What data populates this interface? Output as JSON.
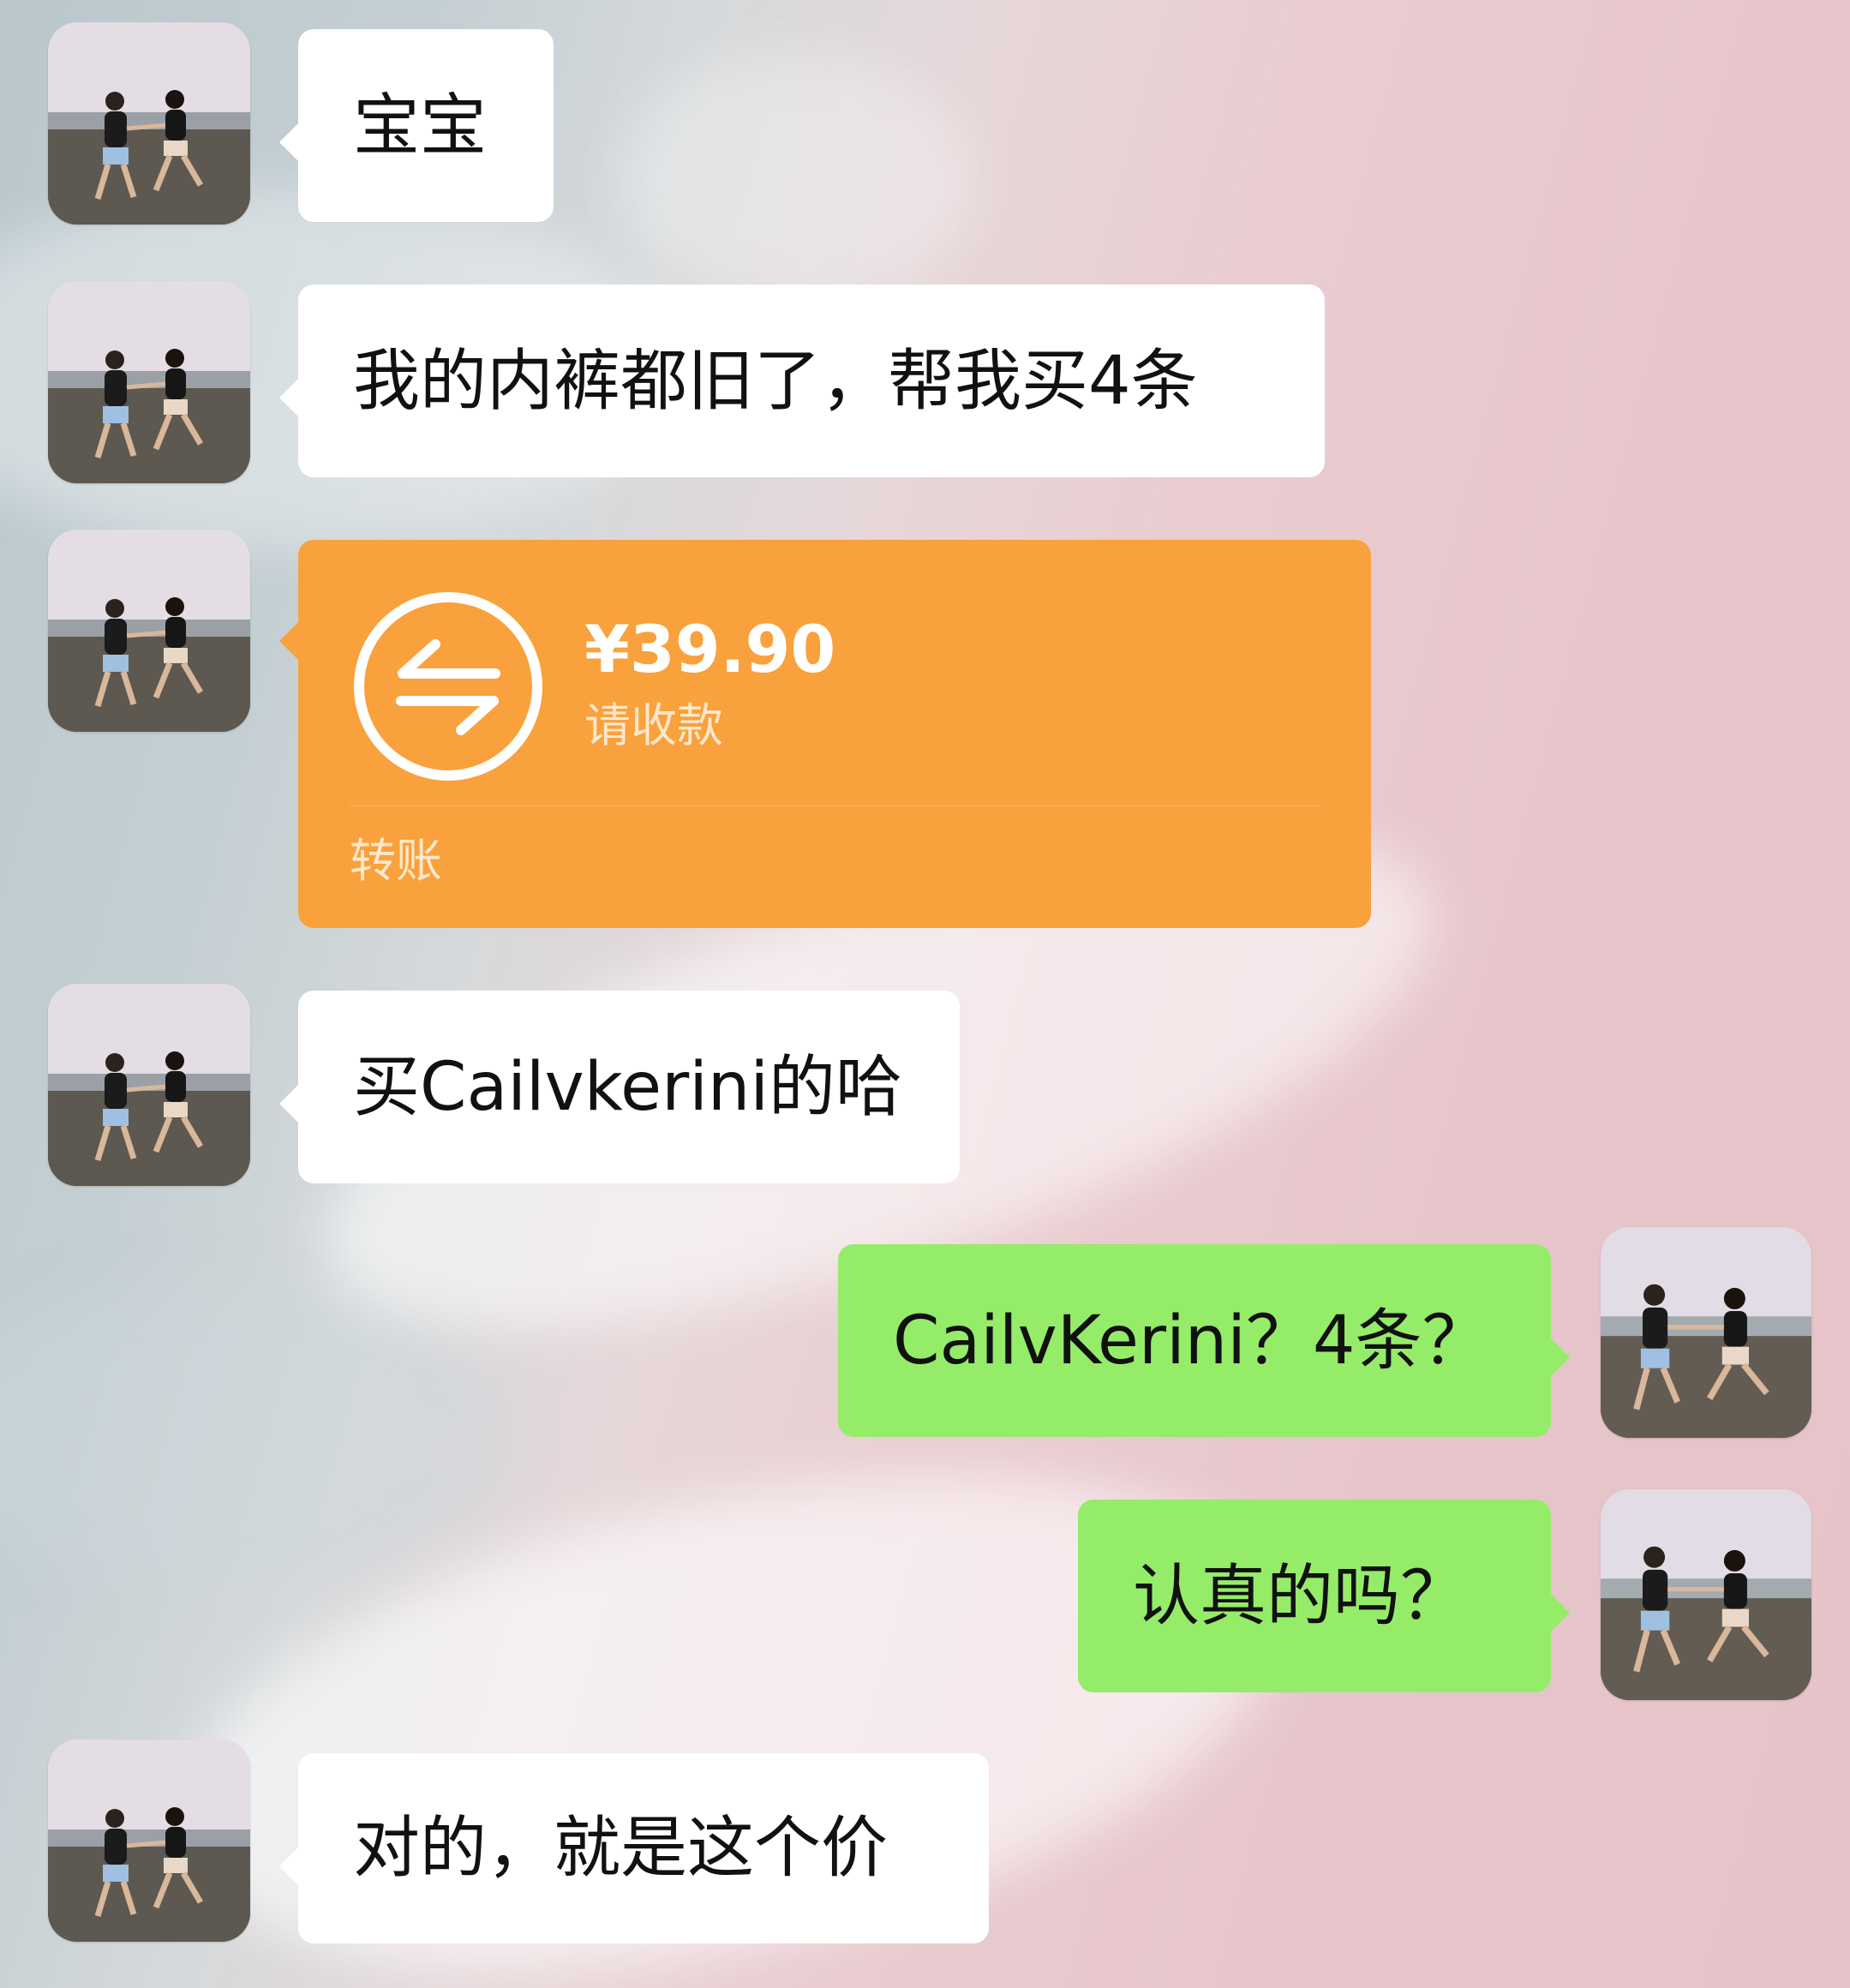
{
  "messages": [
    {
      "side": "left",
      "type": "text",
      "text": "宝宝"
    },
    {
      "side": "left",
      "type": "text",
      "text": "我的内裤都旧了，帮我买4条"
    },
    {
      "side": "left",
      "type": "transfer",
      "amount": "¥39.90",
      "status": "请收款",
      "label": "转账"
    },
    {
      "side": "left",
      "type": "text",
      "text": "买Cailvkerini的哈"
    },
    {
      "side": "right",
      "type": "text",
      "text": "CailvKerini？4条？"
    },
    {
      "side": "right",
      "type": "text",
      "text": "认真的吗？"
    },
    {
      "side": "left",
      "type": "text",
      "text": "对的，就是这个价"
    }
  ],
  "colors": {
    "incoming_bubble": "#ffffff",
    "outgoing_bubble": "#95ec69",
    "transfer_card": "#f9a13c"
  },
  "icons": {
    "transfer": "transfer-arrows-icon",
    "avatar": "avatar-couple-beach"
  }
}
